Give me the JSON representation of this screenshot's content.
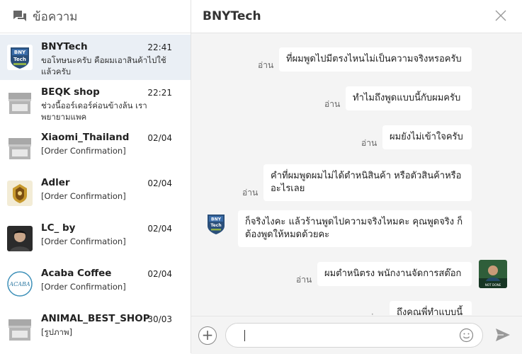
{
  "sidebar": {
    "title": "ข้อความ",
    "conversations": [
      {
        "name": "BNYTech",
        "time": "22:41",
        "preview": "ขอโทษนะครับ คือผมเอาสินค้าไปใช้แล้วครับ"
      },
      {
        "name": "BEQK shop",
        "time": "22:21",
        "preview": "ช่วงนี้ออร์เดอร์ค่อนข้างล้น เราพยายามแพค"
      },
      {
        "name": "Xiaomi_Thailand",
        "time": "02/04",
        "preview": "[Order Confirmation]"
      },
      {
        "name": "Adler",
        "time": "02/04",
        "preview": "[Order Confirmation]"
      },
      {
        "name": "LC_ by",
        "time": "02/04",
        "preview": "[Order Confirmation]"
      },
      {
        "name": "Acaba Coffee",
        "time": "02/04",
        "preview": "[Order Confirmation]"
      },
      {
        "name": "ANIMAL_BEST_SHOP",
        "time": "30/03",
        "preview": "[รูปภาพ]"
      }
    ]
  },
  "chat": {
    "title": "BNYTech",
    "read_label": "อ่าน",
    "messages": [
      {
        "text": "ที่ผมพูดไปมีตรงไหนไม่เป็นความจริงหรอครับ"
      },
      {
        "text": "ทำไมถึงพูดแบบนี้กับผมครับ"
      },
      {
        "text": "ผมยังไม่เข้าใจครับ"
      },
      {
        "text": "คำที่ผมพูดผมไม่ได้ตำหนิสินค้า หรือตัวสินค้าหรืออะไรเลย"
      },
      {
        "text": "ก็จริงไงคะ แล้วร้านพูดไปความจริงไหมคะ คุณพูดจริง ก็ต้องพูดให้หมดด้วยคะ"
      },
      {
        "text": "ผมตำหนิตรง พนักงานจัดการสต๊อก"
      },
      {
        "text": "ถึงคุณพี่ทำแบบนี้"
      }
    ]
  },
  "avatars": {
    "bnytech_logo_text": "BNY Tech",
    "acaba_logo_text": "ACABA",
    "user_avatar_text": "NOT DONE"
  },
  "colors": {
    "active_row": "#eaeff5",
    "chat_bg": "#f4f4f4"
  }
}
